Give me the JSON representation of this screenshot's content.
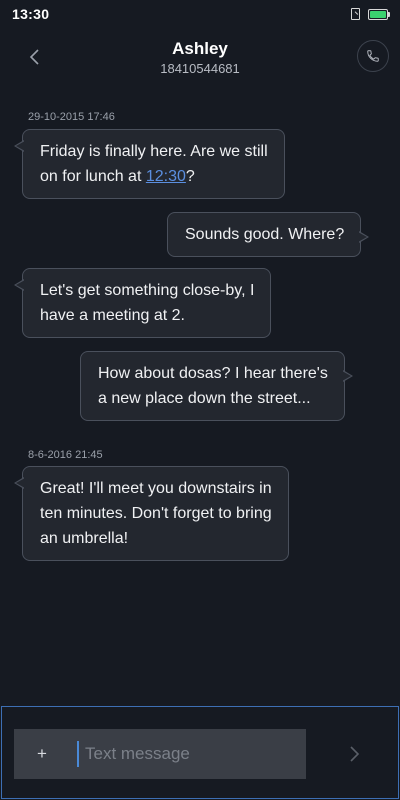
{
  "status_bar": {
    "time": "13:30",
    "icons": [
      "sim-card-icon",
      "battery-icon"
    ],
    "battery_level": 1.0,
    "battery_color": "#3bd16f"
  },
  "header": {
    "back_icon": "chevron-left-icon",
    "contact_name": "Ashley",
    "contact_number": "18410544681",
    "call_icon": "phone-icon"
  },
  "conversation": {
    "timestamps": [
      "29-10-2015 17:46",
      "8-6-2016 21:45"
    ],
    "messages": [
      {
        "direction": "incoming",
        "lines": [
          "Friday is finally here. Are we still",
          "on for lunch at "
        ],
        "link": "12:30",
        "link_suffix": "?"
      },
      {
        "direction": "outgoing",
        "lines": [
          "Sounds good. Where?"
        ]
      },
      {
        "direction": "incoming",
        "lines": [
          "Let's get something close-by, I",
          "have a meeting at 2."
        ]
      },
      {
        "direction": "outgoing",
        "lines": [
          "How about dosas? I hear there's",
          "a new place down the street..."
        ]
      },
      {
        "direction": "incoming",
        "lines": [
          "Great! I'll meet you downstairs in",
          "ten minutes. Don't forget to bring",
          "an umbrella!"
        ]
      }
    ],
    "link_color": "#5b8fe0"
  },
  "composer": {
    "attach_label": "+",
    "placeholder": "Text message",
    "value": "",
    "send_icon": "chevron-right-icon",
    "accent_color": "#3d6fb4"
  }
}
